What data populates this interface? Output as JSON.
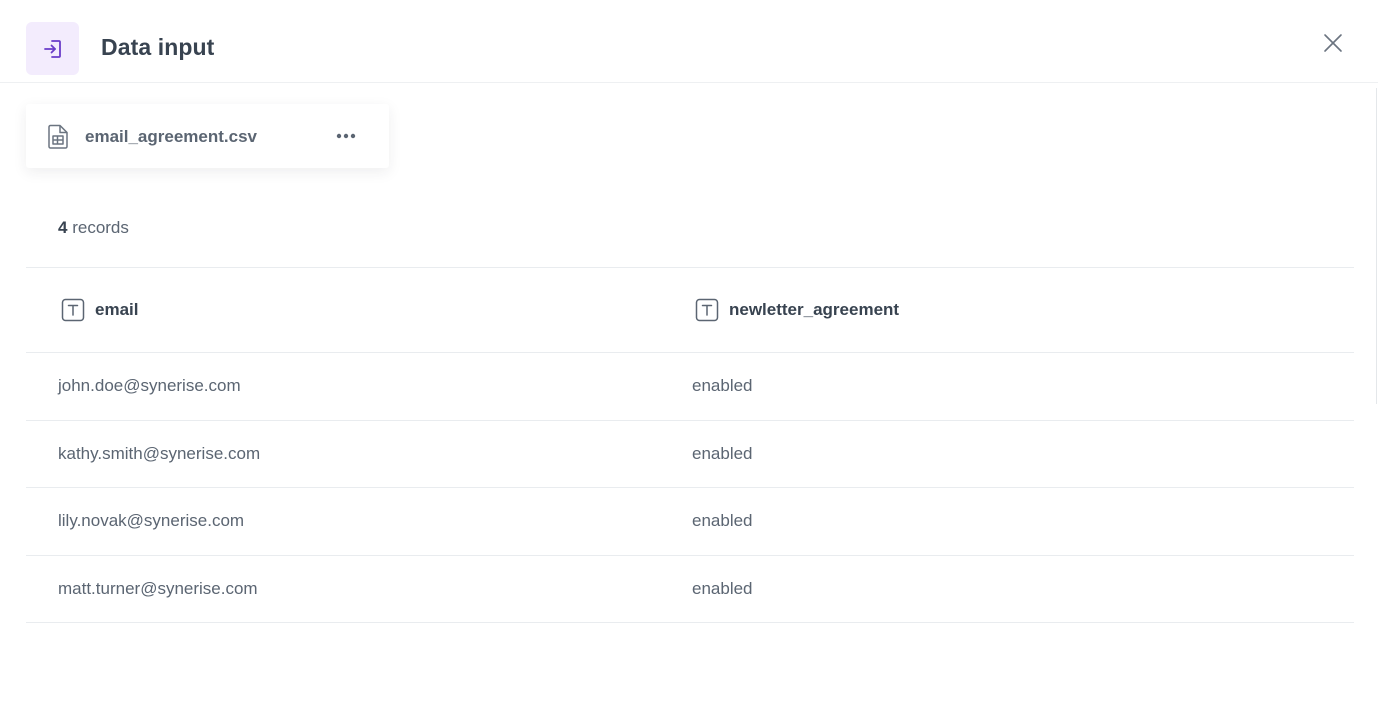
{
  "header": {
    "title": "Data input",
    "icon": "sign-in-icon",
    "accent_color": "#6a3cc9",
    "icon_bg": "#f3ecfd"
  },
  "file": {
    "name": "email_agreement.csv",
    "icon": "spreadsheet-file-icon"
  },
  "summary": {
    "count": "4",
    "label": "records"
  },
  "table": {
    "columns": [
      {
        "label": "email",
        "type_icon": "text-type-icon"
      },
      {
        "label": "newletter_agreement",
        "type_icon": "text-type-icon"
      }
    ],
    "rows": [
      [
        "john.doe@synerise.com",
        "enabled"
      ],
      [
        "kathy.smith@synerise.com",
        "enabled"
      ],
      [
        "lily.novak@synerise.com",
        "enabled"
      ],
      [
        "matt.turner@synerise.com",
        "enabled"
      ]
    ]
  }
}
